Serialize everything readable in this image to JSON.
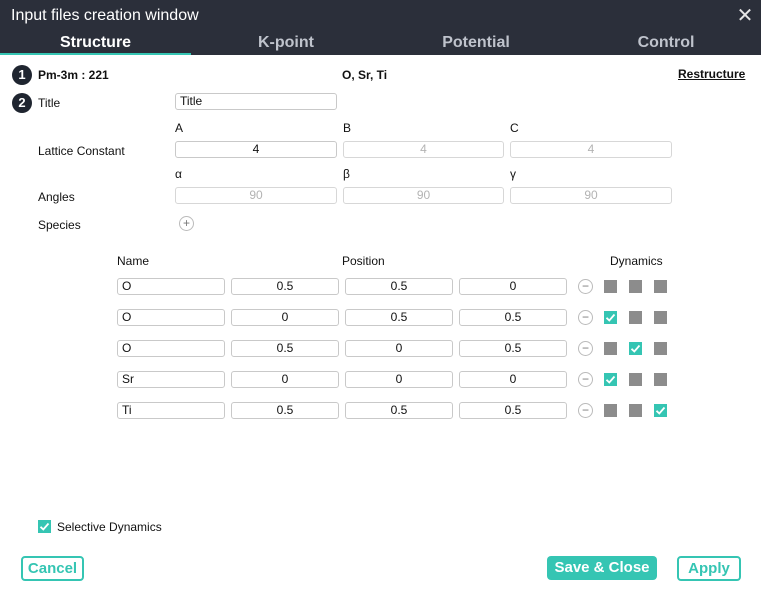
{
  "window": {
    "title": "Input files creation window"
  },
  "tabs": [
    "Structure",
    "K-point",
    "Potential",
    "Control"
  ],
  "header": {
    "step1": "1",
    "step2": "2",
    "spacegroup": "Pm-3m : 221",
    "elements": "O, Sr, Ti",
    "restructure": "Restructure"
  },
  "form": {
    "title_label": "Title",
    "title_value": "Title",
    "lattice_label": "Lattice Constant",
    "angles_label": "Angles",
    "species_label": "Species",
    "abc": [
      "A",
      "B",
      "C"
    ],
    "lattice": [
      "4",
      "4",
      "4"
    ],
    "greek": [
      "α",
      "β",
      "γ"
    ],
    "angles": [
      "90",
      "90",
      "90"
    ]
  },
  "table": {
    "name_header": "Name",
    "position_header": "Position",
    "dynamics_header": "Dynamics",
    "rows": [
      {
        "name": "O",
        "pos": [
          "0.5",
          "0.5",
          "0"
        ],
        "dyn": [
          false,
          false,
          false
        ]
      },
      {
        "name": "O",
        "pos": [
          "0",
          "0.5",
          "0.5"
        ],
        "dyn": [
          true,
          false,
          false
        ]
      },
      {
        "name": "O",
        "pos": [
          "0.5",
          "0",
          "0.5"
        ],
        "dyn": [
          false,
          true,
          false
        ]
      },
      {
        "name": "Sr",
        "pos": [
          "0",
          "0",
          "0"
        ],
        "dyn": [
          true,
          false,
          false
        ]
      },
      {
        "name": "Ti",
        "pos": [
          "0.5",
          "0.5",
          "0.5"
        ],
        "dyn": [
          false,
          false,
          true
        ]
      }
    ]
  },
  "selective_dynamics": {
    "label": "Selective Dynamics",
    "checked": true
  },
  "buttons": {
    "cancel": "Cancel",
    "save_close": "Save & Close",
    "apply": "Apply"
  },
  "colors": {
    "accent": "#35c5b3",
    "titlebar": "#2b2f3a",
    "unchecked": "#8c8c8c"
  }
}
